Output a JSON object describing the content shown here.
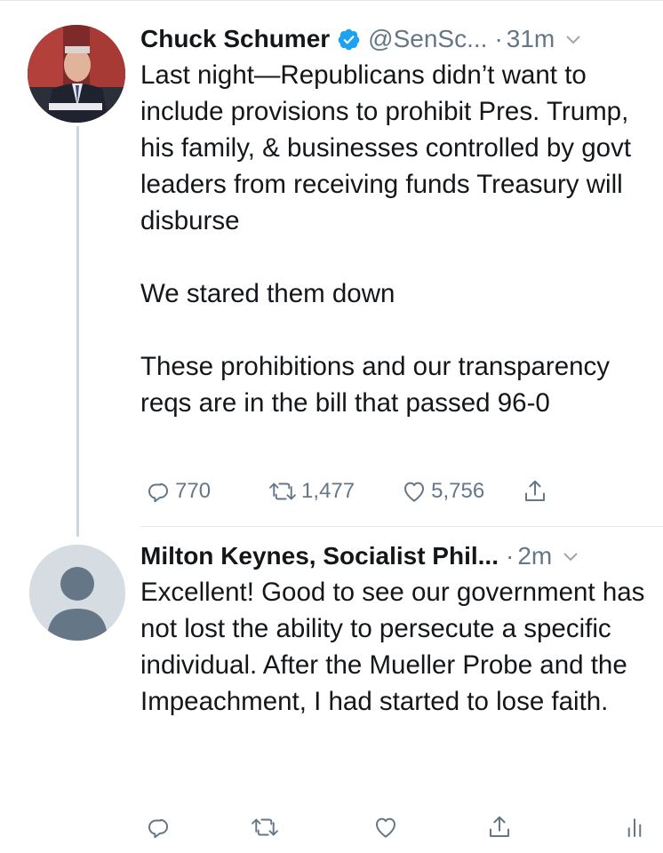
{
  "tweets": [
    {
      "author_name": "Chuck Schumer",
      "handle": "@SenSc...",
      "separator": "·",
      "time": "31m",
      "verified": true,
      "paragraphs": [
        "Last night—Republicans didn’t want to include provisions to prohibit Pres. Trump, his family, & businesses controlled by govt leaders from receiving funds Treasury will disburse",
        "We stared them down",
        "These prohibitions and our transparency reqs are in the bill that passed 96-0"
      ],
      "replies": "770",
      "retweets": "1,477",
      "likes": "5,756"
    },
    {
      "author_name": "Milton Keynes, Socialist Phil...",
      "separator": "·",
      "time": "2m",
      "paragraphs": [
        "Excellent! Good to see our government has not lost the ability to persecute a specific individual. After the Mueller Probe and the Impeachment, I had started to lose faith."
      ]
    }
  ],
  "colors": {
    "text": "#14171a",
    "secondary": "#657786",
    "verified": "#1da1f2",
    "thread_line": "#ccd6dd"
  },
  "icons": [
    "verified-badge-icon",
    "chevron-down-icon",
    "reply-icon",
    "retweet-icon",
    "like-icon",
    "share-icon",
    "analytics-icon",
    "default-avatar-icon"
  ]
}
